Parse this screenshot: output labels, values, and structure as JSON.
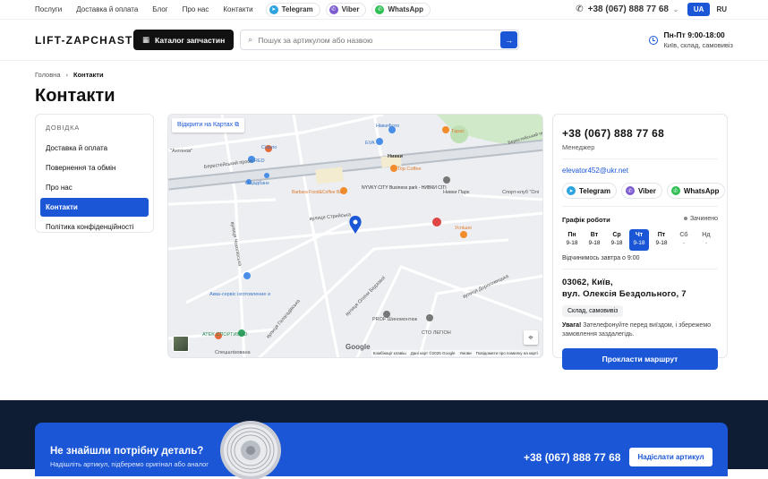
{
  "topbar": {
    "nav": [
      "Послуги",
      "Доставка й оплата",
      "Блог",
      "Про нас",
      "Контакти"
    ],
    "messengers": [
      "Telegram",
      "Viber",
      "WhatsApp"
    ],
    "phone": "+38 (067) 888 77 68",
    "langs": [
      "UA",
      "RU"
    ],
    "active_lang": "UA"
  },
  "header": {
    "logo": "LIFT-ZAPCHAST",
    "catalog_label": "Каталог запчастин",
    "search_placeholder": "Пошук за артикулом або назвою",
    "hours_title": "Пн-Пт 9:00-18:00",
    "hours_sub": "Київ, склад, самовивіз"
  },
  "breadcrumb": {
    "home": "Головна",
    "current": "Контакти"
  },
  "page_title": "Контакти",
  "sidebar": {
    "heading": "ДОВІДКА",
    "items": [
      "Доставка й оплата",
      "Повернення та обмін",
      "Про нас",
      "Контакти",
      "Політика конфіденційності"
    ],
    "active_index": 3
  },
  "map": {
    "open_link": "Відкрити на Картах",
    "brand": "Google",
    "footer": [
      "Комбінації клавіш",
      "Дані карт ©2025 Google",
      "Умови",
      "Повідомити про помилку на карті"
    ],
    "labels": [
      "Берестейський просп.",
      "Берестейський просп.",
      "Нивки",
      "Нивки Парк",
      "Тарас",
      "EVA",
      "Сільпо",
      "НівкиФото",
      "Top Coffee",
      "NYVKY CITY Business park - НИВКИ СІТІ",
      "Barbara Food&Coffee Bar",
      "Ощадбанк",
      "RED",
      "вулиця Стрийська",
      "Успішні",
      "Спорт-клуб \"Олі",
      "PROF Шиномонтаж",
      "СТО ЛЕГІОН",
      "Аква-сервіс ізготовление и",
      "ATEK СПОРТИВНО",
      "Спецшлізована",
      "вулиця Галагадівська",
      "вулиця Олени Бедзової",
      "вулиця Чоколівська",
      "\"Антонов\"",
      "вулиця Дорогожицька"
    ]
  },
  "contact": {
    "phone": "+38 (067) 888 77 68",
    "role": "Менеджер",
    "email": "elevator452@ukr.net",
    "messengers": [
      "Telegram",
      "Viber",
      "WhatsApp"
    ],
    "schedule_title": "Графік роботи",
    "status": "Зачинено",
    "days": [
      {
        "d": "Пн",
        "h": "9-18"
      },
      {
        "d": "Вт",
        "h": "9-18"
      },
      {
        "d": "Ср",
        "h": "9-18"
      },
      {
        "d": "Чт",
        "h": "9-18"
      },
      {
        "d": "Пт",
        "h": "9-18"
      },
      {
        "d": "Сб",
        "h": "-"
      },
      {
        "d": "Нд",
        "h": "-"
      }
    ],
    "today_index": 3,
    "reopen": "Відчинимось завтра о 9:00",
    "address_line1": "03062, Київ,",
    "address_line2": "вул. Олексія Бездольного, 7",
    "chip": "Склад, самовивіз",
    "note_bold": "Увага!",
    "note_text": "Зателефонуйте перед виїздом, і збережемо замовлення заздалегідь.",
    "route_label": "Прокласти маршрут"
  },
  "promo": {
    "heading": "Не знайшли потрібну деталь?",
    "sub": "Надішліть артикул, підберемо оригінал або аналог",
    "phone": "+38 (067) 888 77 68",
    "button": "Надіслати артикул"
  }
}
